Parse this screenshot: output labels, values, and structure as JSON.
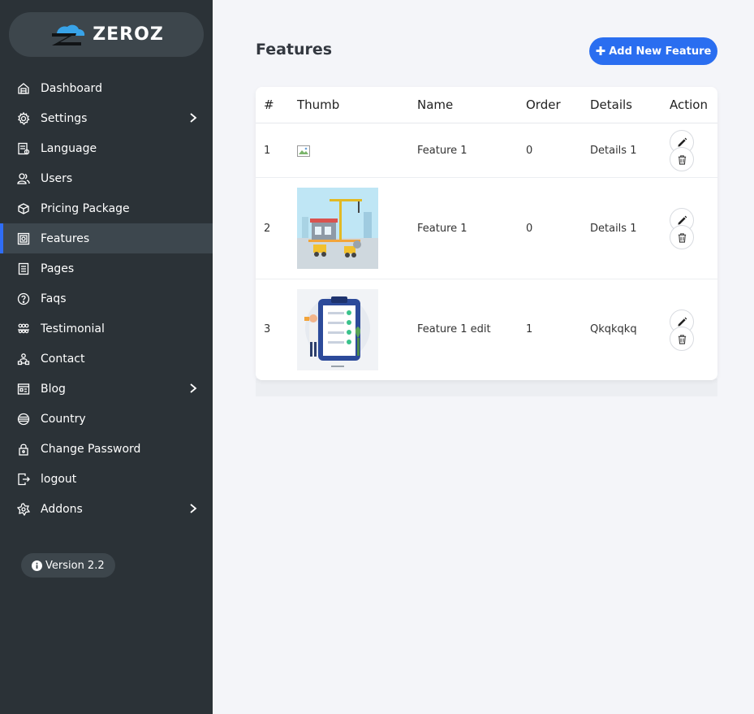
{
  "brand": {
    "name": "ZEROZ"
  },
  "sidebar": {
    "items": [
      {
        "label": "Dashboard",
        "icon": "dashboard-icon",
        "chevron": false,
        "active": false
      },
      {
        "label": "Settings",
        "icon": "settings-icon",
        "chevron": true,
        "active": false
      },
      {
        "label": "Language",
        "icon": "language-icon",
        "chevron": false,
        "active": false
      },
      {
        "label": "Users",
        "icon": "users-icon",
        "chevron": false,
        "active": false
      },
      {
        "label": "Pricing Package",
        "icon": "pricing-icon",
        "chevron": false,
        "active": false
      },
      {
        "label": "Features",
        "icon": "features-icon",
        "chevron": false,
        "active": true
      },
      {
        "label": "Pages",
        "icon": "pages-icon",
        "chevron": false,
        "active": false
      },
      {
        "label": "Faqs",
        "icon": "faqs-icon",
        "chevron": false,
        "active": false
      },
      {
        "label": "Testimonial",
        "icon": "testimonial-icon",
        "chevron": false,
        "active": false
      },
      {
        "label": "Contact",
        "icon": "contact-icon",
        "chevron": false,
        "active": false
      },
      {
        "label": "Blog",
        "icon": "blog-icon",
        "chevron": true,
        "active": false
      },
      {
        "label": "Country",
        "icon": "country-icon",
        "chevron": false,
        "active": false
      },
      {
        "label": "Change Password",
        "icon": "lock-icon",
        "chevron": false,
        "active": false
      },
      {
        "label": "logout",
        "icon": "logout-icon",
        "chevron": false,
        "active": false
      },
      {
        "label": "Addons",
        "icon": "addons-icon",
        "chevron": true,
        "active": false
      }
    ],
    "version": "Version 2.2"
  },
  "main": {
    "title": "Features",
    "add_button": "Add New Feature",
    "table": {
      "headers": {
        "num": "#",
        "thumb": "Thumb",
        "name": "Name",
        "order": "Order",
        "details": "Details",
        "action": "Action"
      },
      "rows": [
        {
          "num": "1",
          "thumb": "broken",
          "name": "Feature 1",
          "order": "0",
          "details": "Details 1"
        },
        {
          "num": "2",
          "thumb": "construction",
          "name": "Feature 1",
          "order": "0",
          "details": "Details 1"
        },
        {
          "num": "3",
          "thumb": "checklist",
          "name": "Feature 1 edit",
          "order": "1",
          "details": "Qkqkqkq"
        }
      ]
    }
  },
  "colors": {
    "sidebar_bg": "#2b3237",
    "active_item_bg": "#3d474e",
    "accent": "#2a6ef0",
    "page_bg": "#f4f5f9"
  }
}
